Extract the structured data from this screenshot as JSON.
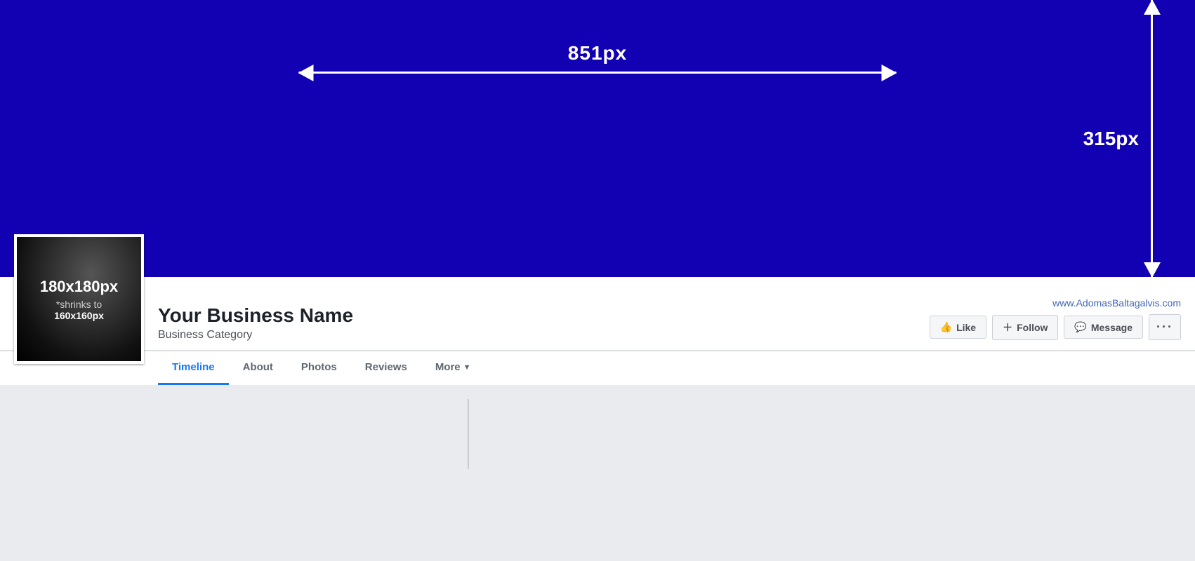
{
  "cover": {
    "width_label": "851px",
    "height_label": "315px",
    "bg_color": "#1200b3"
  },
  "profile": {
    "photo": {
      "size_main": "180x180px",
      "size_sub": "*shrinks to",
      "size_sub2": "160x160px"
    },
    "business_name": "Your Business Name",
    "business_category": "Business Category",
    "website": "www.AdomasBaltagalvis.com"
  },
  "buttons": {
    "like": "Like",
    "follow": "Follow",
    "message": "Message",
    "more": "···"
  },
  "tabs": [
    {
      "label": "Timeline",
      "active": true
    },
    {
      "label": "About",
      "active": false
    },
    {
      "label": "Photos",
      "active": false
    },
    {
      "label": "Reviews",
      "active": false
    },
    {
      "label": "More",
      "active": false,
      "has_dropdown": true
    }
  ]
}
